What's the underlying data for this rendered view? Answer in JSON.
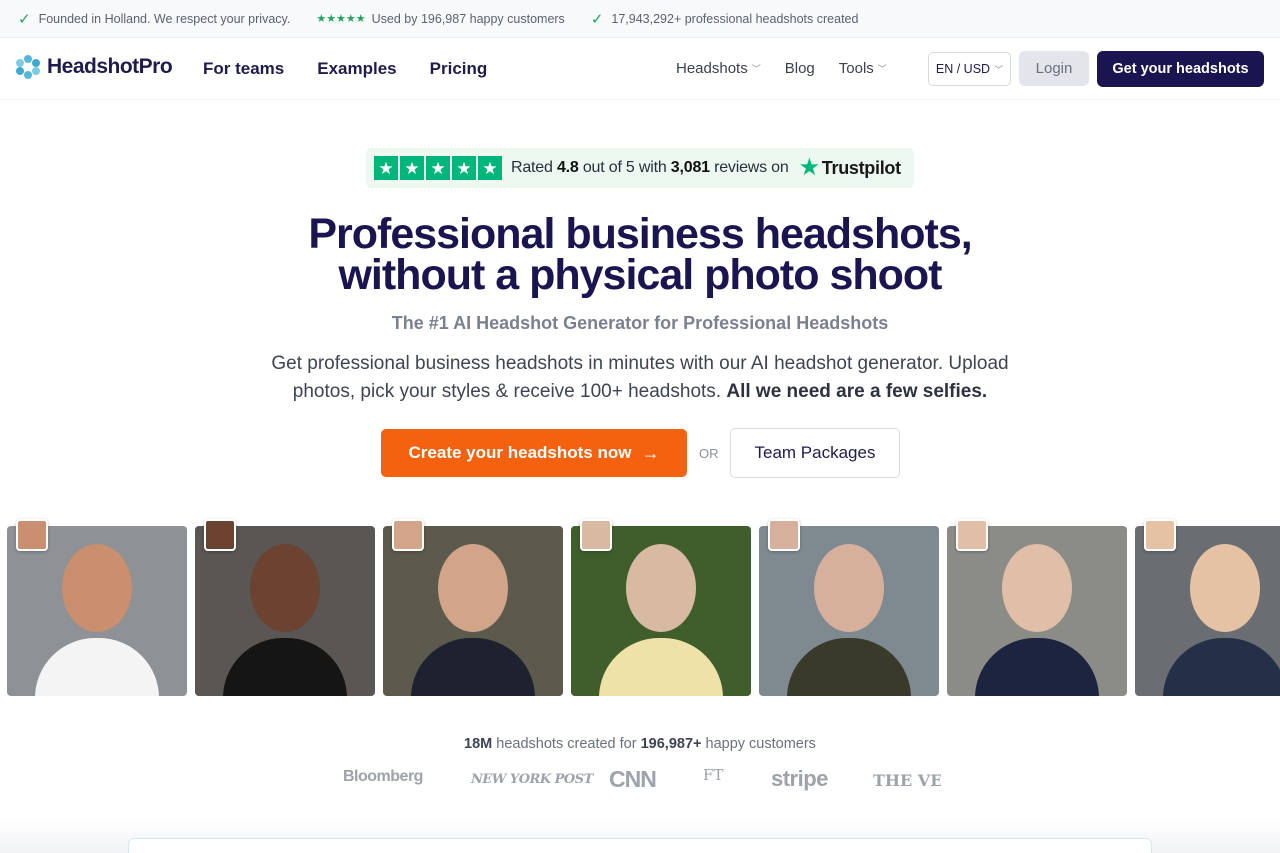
{
  "topbar": {
    "items": [
      {
        "text": "Founded in Holland. We respect your privacy."
      },
      {
        "text": "Used by 196,987 happy customers"
      },
      {
        "text": "17,943,292+ professional headshots created"
      }
    ]
  },
  "nav": {
    "logo": "HeadshotPro",
    "main": [
      "For teams",
      "Examples",
      "Pricing"
    ],
    "right": [
      "Headshots",
      "Blog",
      "Tools"
    ],
    "lang": "EN / USD",
    "login": "Login",
    "cta": "Get your headshots"
  },
  "trust": {
    "prefix": "Rated",
    "rating": "4.8",
    "middle": "out of 5 with",
    "count": "3,081",
    "suffix": "reviews on",
    "brand": "Trustpilot"
  },
  "hero": {
    "title_line1": "Professional business headshots,",
    "title_line2": "without a physical photo shoot",
    "subtitle": "The #1 AI Headshot Generator for Professional Headshots",
    "desc": "Get professional business headshots in minutes with our AI headshot generator. Upload photos, pick your styles & receive 100+ headshots.",
    "desc_bold": "All we need are a few selfies.",
    "cta": "Create your headshots now",
    "or": "OR",
    "secondary": "Team Packages"
  },
  "photos": [
    {
      "bg": "#8e9296",
      "skin": "#c98f6e",
      "cloth": "#f4f4f4"
    },
    {
      "bg": "#5a5654",
      "skin": "#6b4330",
      "cloth": "#151515"
    },
    {
      "bg": "#5c5a4c",
      "skin": "#d2a58a",
      "cloth": "#1e2230"
    },
    {
      "bg": "#3f5e2c",
      "skin": "#d8b9a2",
      "cloth": "#efe2a8"
    },
    {
      "bg": "#7f8a90",
      "skin": "#d6b09a",
      "cloth": "#3a3a2a"
    },
    {
      "bg": "#8b8c86",
      "skin": "#e1bea7",
      "cloth": "#1d2440"
    },
    {
      "bg": "#6a6e72",
      "skin": "#e6c2a4",
      "cloth": "#243047"
    }
  ],
  "stats": {
    "count": "18M",
    "middle": "headshots created for",
    "customers": "196,987+",
    "suffix": "happy customers"
  },
  "press": [
    "Bloomberg",
    "NEW YORK POST",
    "CNN",
    "FT",
    "stripe",
    "THE VERGE"
  ]
}
